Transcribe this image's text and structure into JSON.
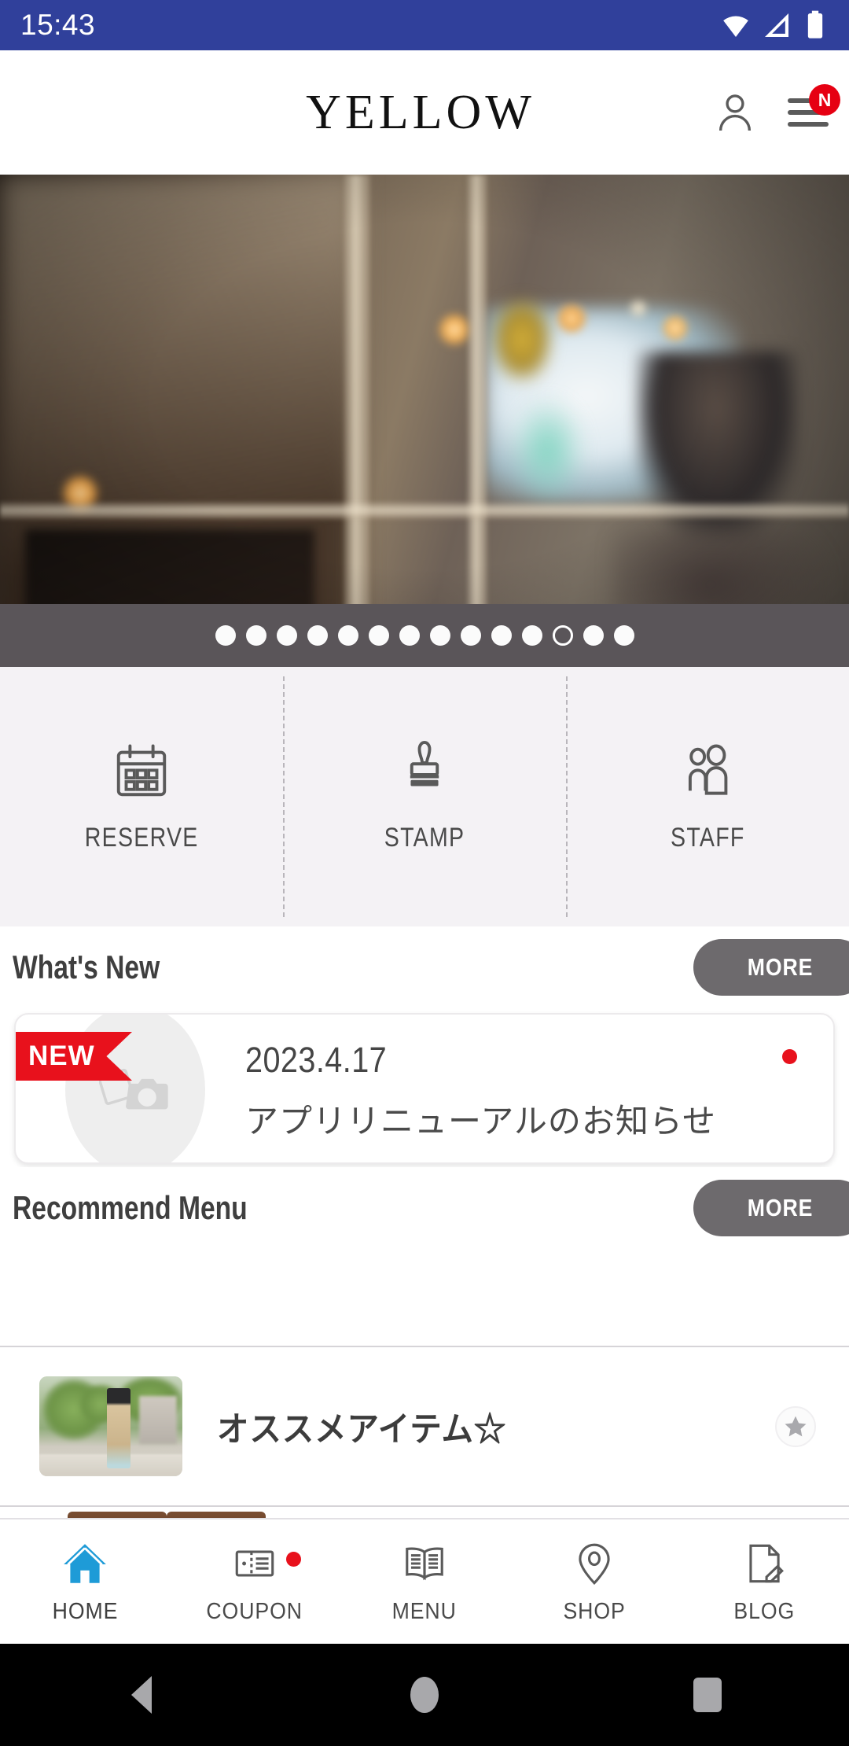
{
  "status_bar": {
    "time": "15:43",
    "icons": [
      "wifi-icon",
      "signal-icon",
      "battery-icon"
    ],
    "background_color": "#30409b"
  },
  "header": {
    "brand": "YELLOW",
    "account_icon": "person-icon",
    "menu_icon": "hamburger-menu-icon",
    "menu_badge": "N",
    "badge_color": "#e60012"
  },
  "hero": {
    "alt": "salon interior window",
    "dots_total": 14,
    "active_dot_index": 11,
    "dots_bar_color": "#5a5559"
  },
  "quick_actions": [
    {
      "label": "RESERVE",
      "icon": "calendar-icon"
    },
    {
      "label": "STAMP",
      "icon": "stamp-icon"
    },
    {
      "label": "STAFF",
      "icon": "people-icon"
    }
  ],
  "whats_new": {
    "title": "What's New",
    "more_label": "MORE",
    "items": [
      {
        "badge": "NEW",
        "date": "2023.4.17",
        "title": "アプリリニューアルのお知らせ",
        "thumb_icon": "photo-placeholder-icon",
        "unread": true
      }
    ]
  },
  "recommend_menu": {
    "title": "Recommend Menu",
    "more_label": "MORE",
    "items": [
      {
        "title": "オススメアイテム☆",
        "thumb": "product-photo",
        "badge_icon": "star-icon"
      }
    ]
  },
  "bottom_nav": {
    "active": "HOME",
    "active_color": "#1e9bd7",
    "items": [
      {
        "label": "HOME",
        "icon": "home-icon",
        "active": true,
        "badge": false
      },
      {
        "label": "COUPON",
        "icon": "coupon-icon",
        "active": false,
        "badge": true
      },
      {
        "label": "MENU",
        "icon": "book-icon",
        "active": false,
        "badge": false
      },
      {
        "label": "SHOP",
        "icon": "location-pin-icon",
        "active": false,
        "badge": false
      },
      {
        "label": "BLOG",
        "icon": "document-pen-icon",
        "active": false,
        "badge": false
      }
    ]
  },
  "system_nav": {
    "back": "back-triangle-icon",
    "home": "home-circle-icon",
    "recents": "recents-square-icon"
  }
}
